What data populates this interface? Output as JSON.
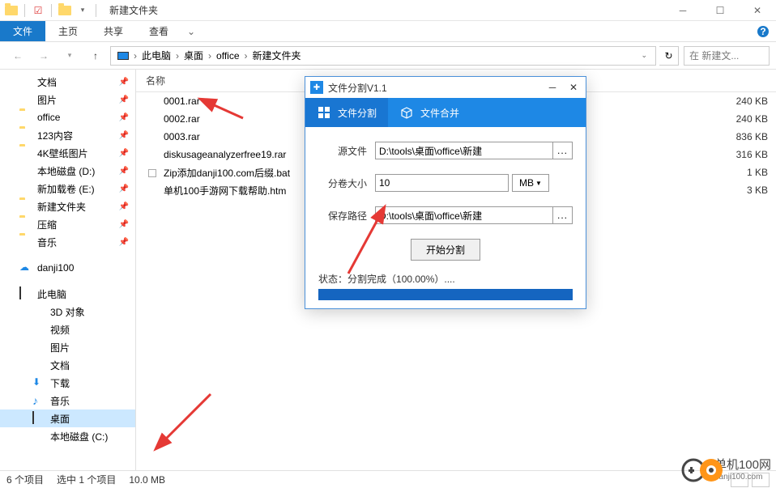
{
  "titlebar": {
    "title": "新建文件夹"
  },
  "ribbon": {
    "file": "文件",
    "home": "主页",
    "share": "共享",
    "view": "查看"
  },
  "breadcrumb": {
    "items": [
      "此电脑",
      "桌面",
      "office",
      "新建文件夹"
    ]
  },
  "search": {
    "placeholder": "在 新建文..."
  },
  "tree": {
    "items": [
      {
        "label": "文档",
        "icon": "doc",
        "pinned": true
      },
      {
        "label": "图片",
        "icon": "pic",
        "pinned": true
      },
      {
        "label": "office",
        "icon": "folder",
        "pinned": true
      },
      {
        "label": "123内容",
        "icon": "folder",
        "pinned": true
      },
      {
        "label": "4K壁纸图片",
        "icon": "folder",
        "pinned": true
      },
      {
        "label": "本地磁盘 (D:)",
        "icon": "disk",
        "pinned": true
      },
      {
        "label": "新加载卷 (E:)",
        "icon": "disk",
        "pinned": true
      },
      {
        "label": "新建文件夹",
        "icon": "folder",
        "pinned": true
      },
      {
        "label": "压缩",
        "icon": "folder",
        "pinned": true
      },
      {
        "label": "音乐",
        "icon": "folder",
        "pinned": true
      },
      {
        "label": "danji100",
        "icon": "cloud"
      },
      {
        "label": "此电脑",
        "icon": "pc"
      },
      {
        "label": "3D 对象",
        "icon": "3d",
        "sub": true
      },
      {
        "label": "视频",
        "icon": "video",
        "sub": true
      },
      {
        "label": "图片",
        "icon": "pic",
        "sub": true
      },
      {
        "label": "文档",
        "icon": "doc",
        "sub": true
      },
      {
        "label": "下载",
        "icon": "download",
        "sub": true
      },
      {
        "label": "音乐",
        "icon": "music",
        "sub": true
      },
      {
        "label": "桌面",
        "icon": "desktop",
        "sub": true,
        "selected": true
      },
      {
        "label": "本地磁盘 (C:)",
        "icon": "disk",
        "sub": true
      }
    ]
  },
  "filelist": {
    "header_name": "名称",
    "files": [
      {
        "name": "0001.rar",
        "icon": "rar",
        "size": "240 KB"
      },
      {
        "name": "0002.rar",
        "icon": "rar",
        "size": "240 KB"
      },
      {
        "name": "0003.rar",
        "icon": "rar",
        "size": "836 KB"
      },
      {
        "name": "diskusageanalyzerfree19.rar",
        "icon": "rar",
        "size": "316 KB"
      },
      {
        "name": "Zip添加danji100.com后缀.bat",
        "icon": "bat",
        "size": "1 KB"
      },
      {
        "name": "单机100手游网下载帮助.htm",
        "icon": "htm",
        "size": "3 KB"
      }
    ]
  },
  "dialog": {
    "title": "文件分割V1.1",
    "tab_split": "文件分割",
    "tab_merge": "文件合并",
    "label_source": "源文件",
    "value_source": "D:\\tools\\桌面\\office\\新建",
    "label_size": "分卷大小",
    "value_size": "10",
    "unit": "MB",
    "label_savepath": "保存路径",
    "value_savepath": "D:\\tools\\桌面\\office\\新建",
    "button_start": "开始分割",
    "status_label": "状态：",
    "status_text": "分割完成（100.00%）...."
  },
  "statusbar": {
    "count": "6 个项目",
    "selected": "选中 1 个项目",
    "size": "10.0 MB"
  },
  "watermark": {
    "cn": "单机100网",
    "url": "danji100.com"
  }
}
